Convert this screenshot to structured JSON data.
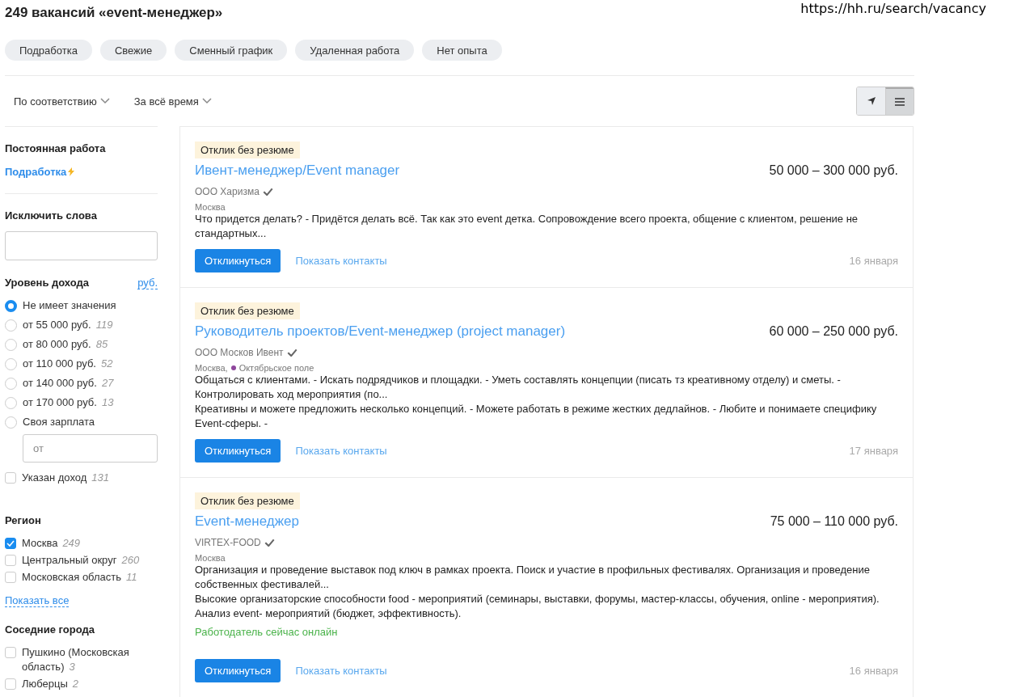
{
  "heading": "249 вакансий «event-менеджер»",
  "url": "https://hh.ru/search/vacancy",
  "chips": [
    "Подработка",
    "Свежие",
    "Сменный график",
    "Удаленная работа",
    "Нет опыта"
  ],
  "sort": [
    {
      "label": "По соответствию"
    },
    {
      "label": "За всё время"
    }
  ],
  "view_toggle": [
    {
      "kind": "map",
      "selected": false
    },
    {
      "kind": "list",
      "selected": true
    }
  ],
  "sidebar": {
    "employment": {
      "title": "Постоянная работа",
      "link": "Подработка"
    },
    "exclude": {
      "title": "Исключить слова"
    },
    "income": {
      "title": "Уровень дохода",
      "currency": "руб.",
      "options": [
        {
          "label": "Не имеет значения",
          "selected": true
        },
        {
          "label": "от 55 000 руб.",
          "count": "119",
          "selected": false
        },
        {
          "label": "от 80 000 руб.",
          "count": "85",
          "selected": false
        },
        {
          "label": "от 110 000 руб.",
          "count": "52",
          "selected": false
        },
        {
          "label": "от 140 000 руб.",
          "count": "27",
          "selected": false
        },
        {
          "label": "от 170 000 руб.",
          "count": "13",
          "selected": false
        },
        {
          "label": "Своя зарплата",
          "selected": false
        }
      ],
      "custom_placeholder": "от",
      "specified": {
        "label": "Указан доход",
        "count": "131",
        "checked": false
      }
    },
    "region": {
      "title": "Регион",
      "items": [
        {
          "label": "Москва",
          "count": "249",
          "checked": true
        },
        {
          "label": "Центральный округ",
          "count": "260",
          "checked": false
        },
        {
          "label": "Московская область",
          "count": "11",
          "checked": false
        }
      ],
      "show_all": "Показать все"
    },
    "nearby": {
      "title": "Соседние города",
      "items": [
        {
          "label": "Пушкино (Московская область)",
          "count": "3",
          "checked": false
        },
        {
          "label": "Люберцы",
          "count": "2",
          "checked": false
        }
      ]
    }
  },
  "vacancies": [
    {
      "badge": "Отклик без резюме",
      "title": "Ивент-менеджер/Event manager",
      "salary": "50 000 – 300 000 руб.",
      "company": "ООО Харизма",
      "location": "Москва",
      "snippets": [
        "Что придется делать? - Придётся делать всё. Так как это event детка. Сопровождение всего проекта, общение с клиентом, решение не стандартных..."
      ],
      "respond": "Откликнуться",
      "contacts": "Показать контакты",
      "date": "16 января"
    },
    {
      "badge": "Отклик без резюме",
      "title": "Руководитель проектов/Event-менеджер (project manager)",
      "salary": "60 000 – 250 000 руб.",
      "company": "ООО Москов Ивент",
      "location": "Москва,",
      "metro": {
        "name": "Октябрьское поле",
        "color": "#8e479c"
      },
      "snippets": [
        "Общаться с клиентами. - Искать подрядчиков и площадки. - Уметь составлять концепции (писать тз креативному отделу) и сметы. - Контролировать ход мероприятия (по...",
        "Креативны и можете предложить несколько концепций. - Можете работать в режиме жестких дедлайнов. - Любите и понимаете специфику Event-сферы. -"
      ],
      "respond": "Откликнуться",
      "contacts": "Показать контакты",
      "date": "17 января"
    },
    {
      "badge": "Отклик без резюме",
      "title": "Event-менеджер",
      "salary": "75 000 – 110 000 руб.",
      "company": "VIRTEX-FOOD",
      "location": "Москва",
      "snippets": [
        "Организация и проведение выставок под ключ в рамках проекта. Поиск и участие в профильных фестивалях. Организация и проведение собственных фестивалей...",
        "Высокие организаторские способности food - мероприятий (семинары, выставки, форумы, мастер-классы, обучения, online - мероприятия). Анализ event- мероприятий (бюджет, эффективность)."
      ],
      "online": "Работодатель сейчас онлайн",
      "respond": "Откликнуться",
      "contacts": "Показать контакты",
      "date": "16 января"
    }
  ]
}
